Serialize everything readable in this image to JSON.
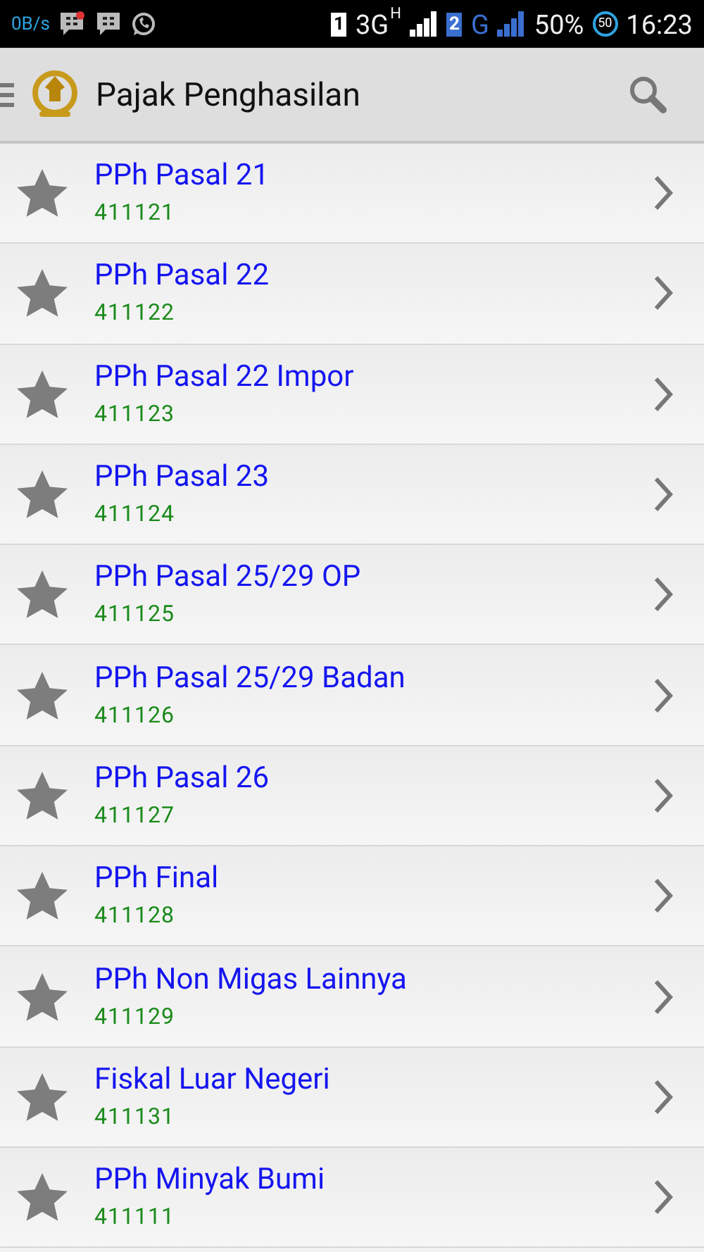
{
  "status_bar": {
    "speed": "0B/s",
    "sim1": "1",
    "network1": "3G",
    "network1_sup": "H",
    "sim2": "2",
    "network2": "G",
    "battery": "50%",
    "battery_badge": "50",
    "time": "16:23"
  },
  "app_bar": {
    "title": "Pajak Penghasilan"
  },
  "items": [
    {
      "title": "PPh Pasal 21",
      "code": "411121"
    },
    {
      "title": "PPh Pasal 22",
      "code": "411122"
    },
    {
      "title": "PPh Pasal 22 Impor",
      "code": "411123"
    },
    {
      "title": "PPh Pasal 23",
      "code": "411124"
    },
    {
      "title": "PPh Pasal 25/29 OP",
      "code": "411125"
    },
    {
      "title": "PPh Pasal 25/29 Badan",
      "code": "411126"
    },
    {
      "title": "PPh Pasal 26",
      "code": "411127"
    },
    {
      "title": "PPh Final",
      "code": "411128"
    },
    {
      "title": "PPh Non Migas Lainnya",
      "code": "411129"
    },
    {
      "title": "Fiskal Luar Negeri",
      "code": "411131"
    },
    {
      "title": "PPh Minyak Bumi",
      "code": "411111"
    }
  ]
}
